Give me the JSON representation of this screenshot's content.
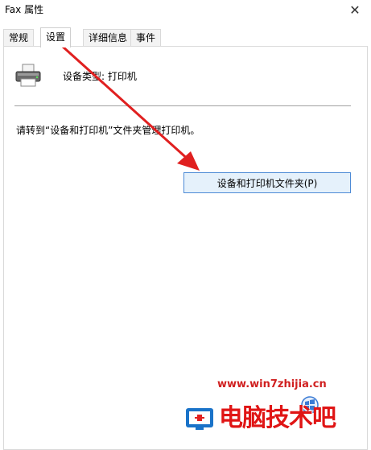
{
  "window": {
    "title": "Fax 属性"
  },
  "tabs": [
    {
      "label": "常规"
    },
    {
      "label": "设置"
    },
    {
      "label": "详细信息"
    },
    {
      "label": "事件"
    }
  ],
  "settings": {
    "device_type": "设备类型: 打印机",
    "instruction": "请转到“设备和打印机”文件夹管理打印机。",
    "folder_button": "设备和打印机文件夹(P)"
  },
  "watermark": {
    "url": "www.win7zhijia.cn",
    "brand": "电脑技术吧"
  },
  "colors": {
    "arrow": "#e02020",
    "button_border": "#4d8bd6",
    "button_bg": "#e5f1fb"
  }
}
